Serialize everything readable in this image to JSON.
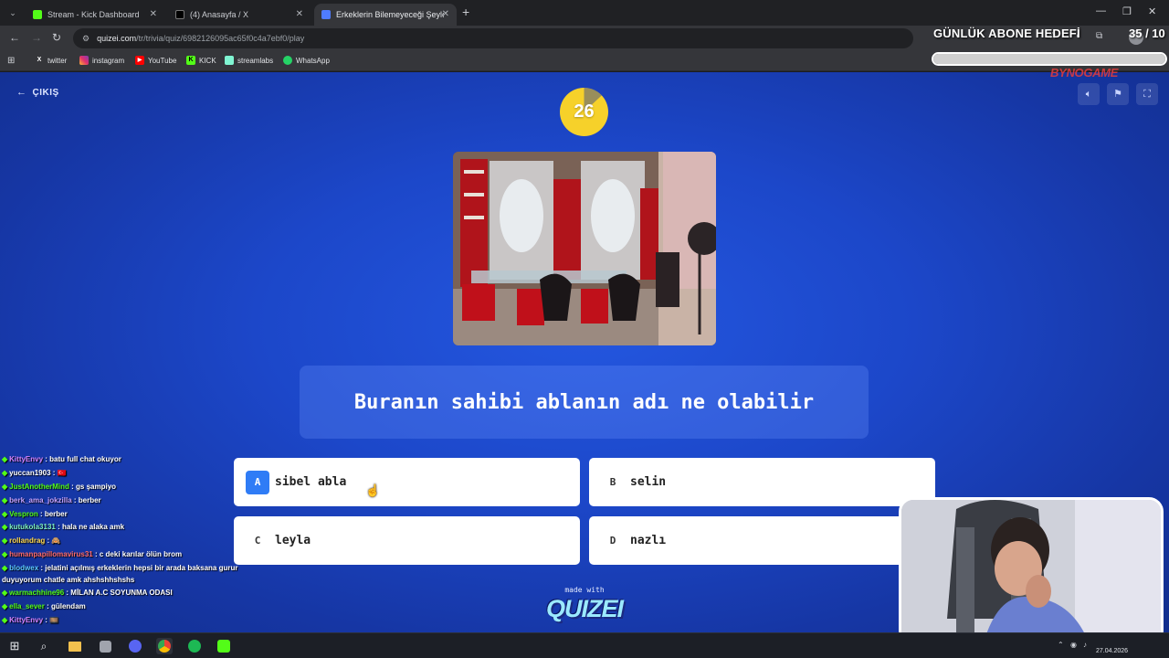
{
  "browser": {
    "tabs": [
      {
        "title": "Stream - Kick Dashboard",
        "icon": "kick-icon",
        "active": false
      },
      {
        "title": "(4) Anasayfa / X",
        "icon": "x-icon",
        "active": false
      },
      {
        "title": "Erkeklerin Bilemeyeceği Şeyler",
        "icon": "quizei-icon",
        "active": true
      }
    ],
    "url_host": "quizei.com",
    "url_path": "/tr/trivia/quiz/6982126095ac65f0c4a7ebf0/play",
    "bookmarks": [
      {
        "label": "twitter",
        "icon": "x-icon"
      },
      {
        "label": "instagram",
        "icon": "instagram-icon"
      },
      {
        "label": "YouTube",
        "icon": "youtube-icon"
      },
      {
        "label": "KICK",
        "icon": "kick-icon"
      },
      {
        "label": "streamlabs",
        "icon": "streamlabs-icon"
      },
      {
        "label": "WhatsApp",
        "icon": "whatsapp-icon"
      }
    ]
  },
  "overlay": {
    "goal_title": "GÜNLÜK ABONE HEDEFİ",
    "goal_count": "35 / 10",
    "goal_progress": 1.0,
    "sponsor": "BYNOGAME"
  },
  "quiz": {
    "exit_label": "ÇIKIŞ",
    "timer": "26",
    "timer_remaining_fraction": 0.87,
    "question": "Buranın sahibi ablanın adı ne olabilir",
    "answers": [
      {
        "letter": "A",
        "label": "sibel abla",
        "selected": true
      },
      {
        "letter": "B",
        "label": "selin",
        "selected": false
      },
      {
        "letter": "C",
        "label": "leyla",
        "selected": false
      },
      {
        "letter": "D",
        "label": "nazlı",
        "selected": false
      }
    ],
    "made_with": "made with",
    "brand": "QUIZEI"
  },
  "chat": [
    {
      "user": "KittyEnvy",
      "user_color": "#d684ff",
      "message": "batu full chat okuyor"
    },
    {
      "user": "yuccan1903",
      "user_color": "#ffffff",
      "message": "🇹🇷"
    },
    {
      "user": "JustAnotherMind",
      "user_color": "#53fc18",
      "message": "gs şampiyo"
    },
    {
      "user": "berk_ama_jokzilla",
      "user_color": "#c6a2ff",
      "message": "berber"
    },
    {
      "user": "Vespron",
      "user_color": "#53fc18",
      "message": "berber"
    },
    {
      "user": "kutukola3131",
      "user_color": "#7ef0c0",
      "message": "hala ne alaka amk"
    },
    {
      "user": "rollandrag",
      "user_color": "#ffd84d",
      "message": "🙈"
    },
    {
      "user": "humanpapillomavirus31",
      "user_color": "#ff6b6b",
      "message": "c deki karılar ölün brom"
    },
    {
      "user": "blodwex",
      "user_color": "#5cc8ff",
      "message": "jelatini açılmış erkeklerin hepsi bir arada baksana gurur"
    },
    {
      "user": "",
      "user_color": "#ffffff",
      "message": "duyuyorum chatle amk ahshshhshshs"
    },
    {
      "user": "warmachhine96",
      "user_color": "#53fc18",
      "message": "MİLAN A.C SOYUNMA ODASI"
    },
    {
      "user": "ella_sever",
      "user_color": "#53fc18",
      "message": "gülendam"
    },
    {
      "user": "KittyEnvy",
      "user_color": "#d684ff",
      "message": "🎞️"
    }
  ],
  "taskbar": {
    "date": "27.04.2026",
    "apps": [
      "windows-icon",
      "search-icon",
      "file-explorer-icon",
      "app-icon",
      "discord-icon",
      "chrome-icon",
      "spotify-icon",
      "kick-studio-icon"
    ]
  },
  "colors": {
    "accent": "#2f7cf6",
    "timer": "#f6d12a",
    "kick_green": "#53fc18"
  }
}
